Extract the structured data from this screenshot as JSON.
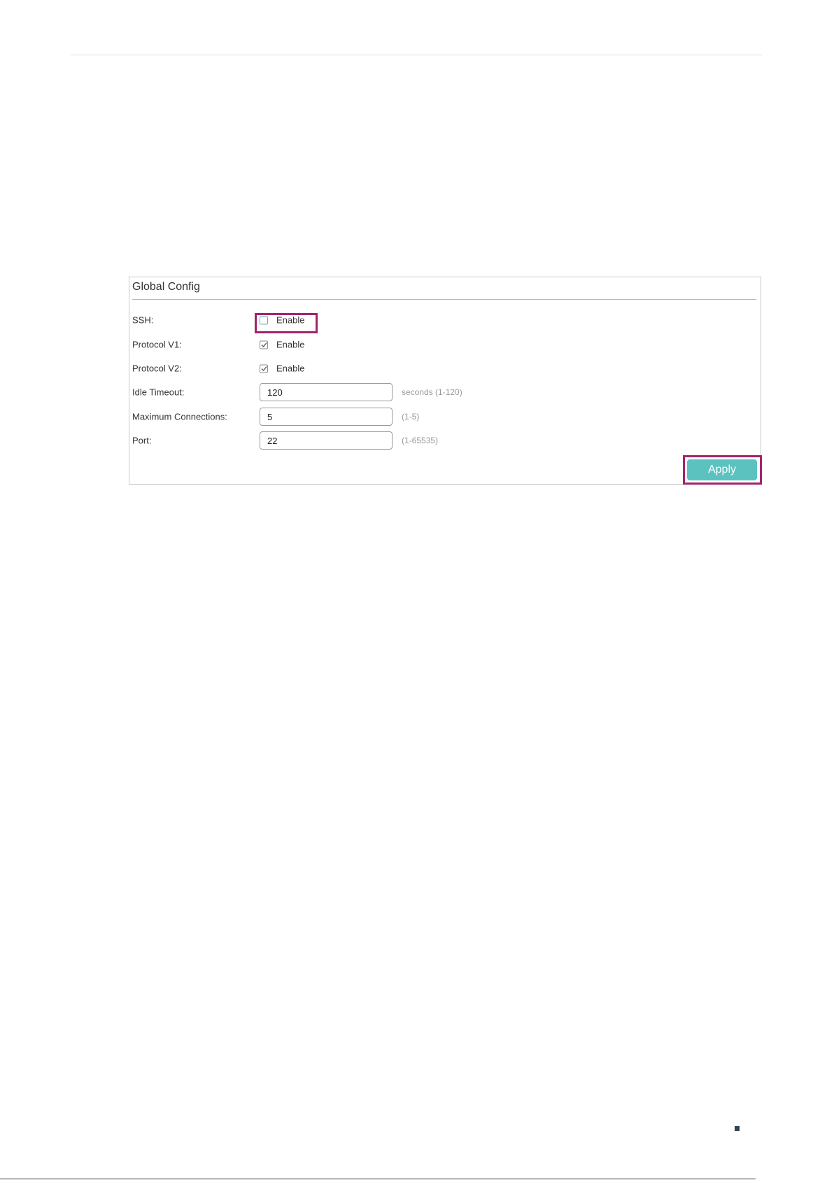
{
  "panel": {
    "title": "Global Config"
  },
  "form": {
    "ssh": {
      "label": "SSH:",
      "option_label": "Enable",
      "checked": false
    },
    "protocol_v1": {
      "label": "Protocol V1:",
      "option_label": "Enable",
      "checked": true
    },
    "protocol_v2": {
      "label": "Protocol V2:",
      "option_label": "Enable",
      "checked": true
    },
    "idle_timeout": {
      "label": "Idle Timeout:",
      "value": "120",
      "hint": "seconds (1-120)"
    },
    "max_connections": {
      "label": "Maximum Connections:",
      "value": "5",
      "hint": "(1-5)"
    },
    "port": {
      "label": "Port:",
      "value": "22",
      "hint": "(1-65535)"
    }
  },
  "actions": {
    "apply_label": "Apply"
  },
  "colors": {
    "accent": "#5bc2bf",
    "highlight": "#a3226e",
    "marker": "#2f4454"
  },
  "icons": {
    "checkmark": "check-icon"
  }
}
